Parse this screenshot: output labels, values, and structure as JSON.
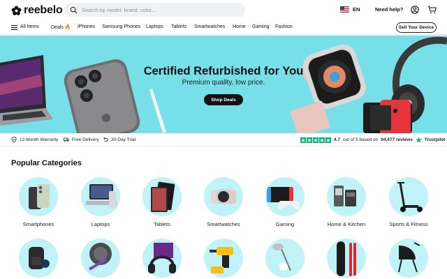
{
  "header": {
    "logo_text": "reebelo",
    "search_placeholder": "Search by model, brand, color...",
    "language": "EN",
    "help_label": "Need help?"
  },
  "nav": {
    "items": [
      "All Items",
      "Deals 🔥",
      "iPhones",
      "Samsung Phones",
      "Laptops",
      "Tablets",
      "Smartwatches",
      "Home",
      "Gaming",
      "Fashion"
    ],
    "sell_label": "Sell Your Device"
  },
  "hero": {
    "title": "Certified Refurbished for You",
    "subtitle": "Premium quality, low price.",
    "button_label": "Shop Deals",
    "background": "#76dfe8"
  },
  "trust": {
    "warranty": "12-Month Warranty",
    "delivery": "Free Delivery",
    "trial": "30-Day Trial",
    "rating_prefix": "4.7",
    "rating_text": "out of 5 based on",
    "review_count": "94,477 reviews",
    "brand": "Trustpilot",
    "star_color": "#00b67a"
  },
  "categories": {
    "title": "Popular Categories",
    "items": [
      "Smartphones",
      "Laptops",
      "Tablets",
      "Smartwatches",
      "Gaming",
      "Home & Kitchen",
      "Sports & Fitness"
    ],
    "circle_color": "#bff3f7"
  }
}
